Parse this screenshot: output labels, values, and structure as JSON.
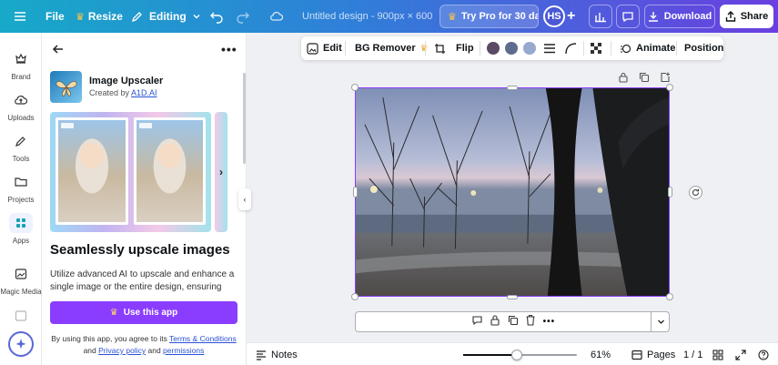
{
  "topbar": {
    "file": "File",
    "resize": "Resize",
    "editing": "Editing",
    "title": "Untitled design - 900px × 600...",
    "try_pro": "Try Pro for 30 da...",
    "avatar_initials": "HS",
    "download": "Download",
    "share": "Share"
  },
  "rail": {
    "items": [
      {
        "label": "Brand",
        "icon": "crown-icon"
      },
      {
        "label": "Uploads",
        "icon": "cloud-upload-icon"
      },
      {
        "label": "Tools",
        "icon": "pen-tools-icon"
      },
      {
        "label": "Projects",
        "icon": "folder-icon"
      },
      {
        "label": "Apps",
        "icon": "apps-grid-icon"
      },
      {
        "label": "Magic Media",
        "icon": "magic-media-icon"
      }
    ]
  },
  "panel": {
    "app_name": "Image Upscaler",
    "created_by_prefix": "Created by",
    "created_by_link": "A1D.AI",
    "heading": "Seamlessly upscale images",
    "description": "Utilize advanced AI to upscale and enhance a single image or the entire design, ensuring",
    "use_button": "Use this app",
    "terms_prefix": "By using this app, you agree to its",
    "terms_link": "Terms & Conditions",
    "terms_and": "and",
    "privacy_link": "Privacy policy",
    "terms_and2": "and",
    "permissions_link": "permissions"
  },
  "context_toolbar": {
    "edit": "Edit",
    "bg_remover": "BG Remover",
    "flip": "Flip",
    "animate": "Animate",
    "position": "Position",
    "swatches": [
      "#5b4a63",
      "#5e6c8f",
      "#97a9cf"
    ]
  },
  "bottombar": {
    "notes": "Notes",
    "zoom": "61%",
    "zoom_fraction": 0.47,
    "pages": "Pages",
    "page_count": "1 / 1"
  }
}
